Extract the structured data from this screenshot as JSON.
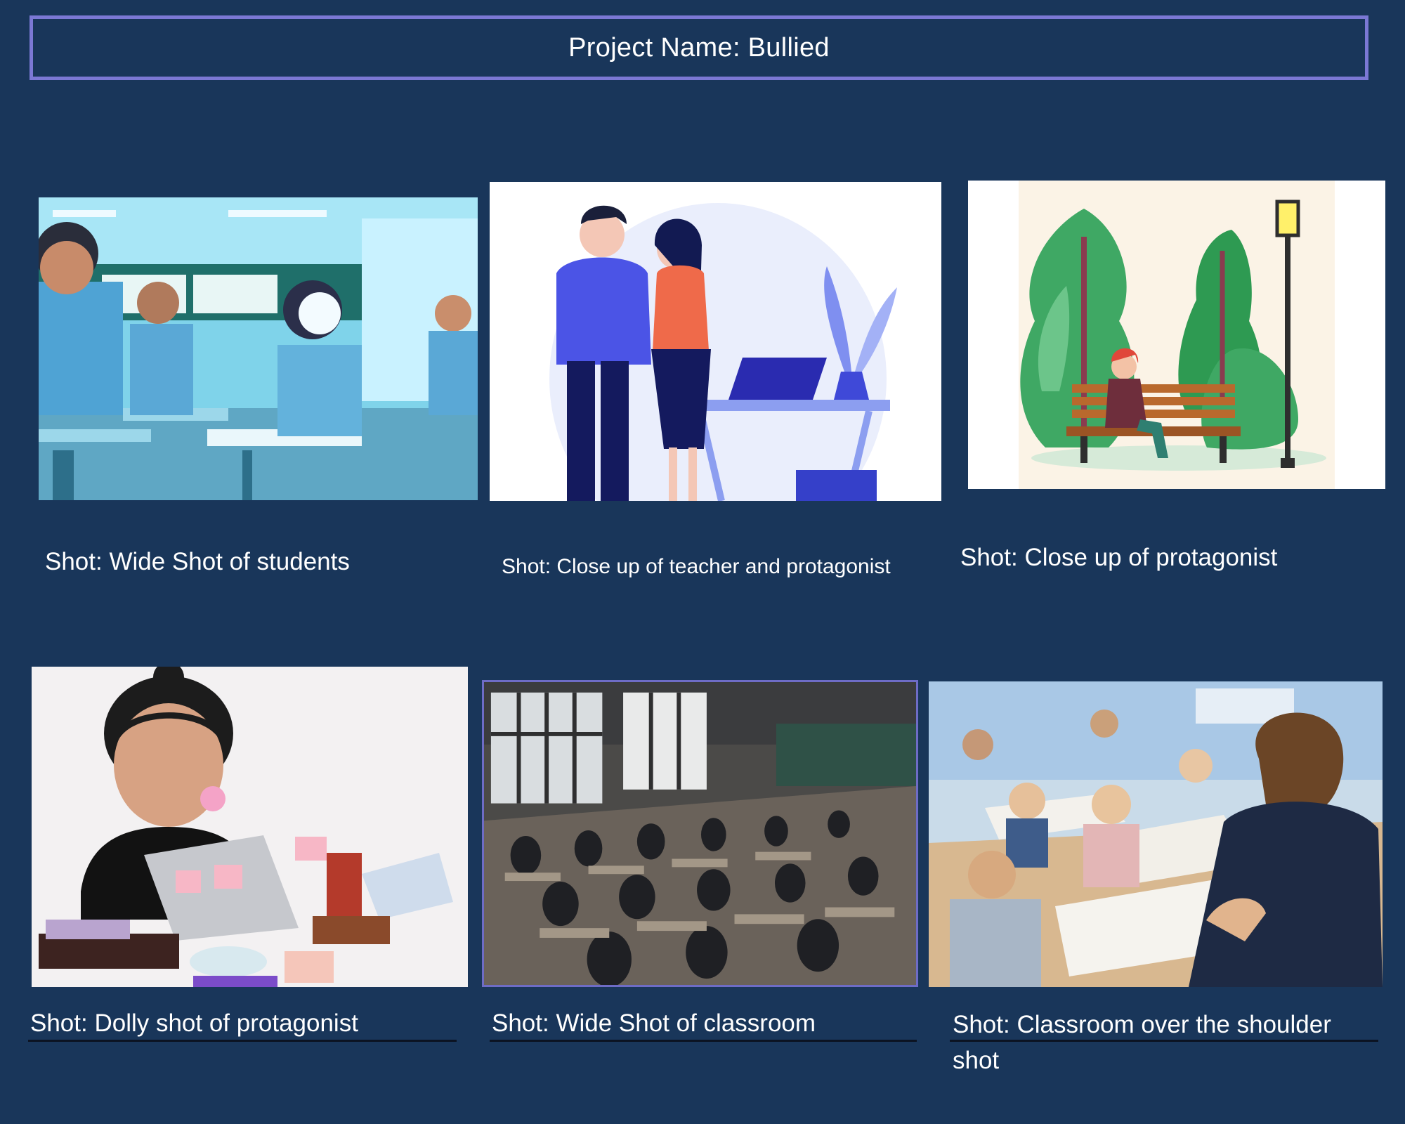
{
  "project": {
    "title": "Project Name: Bullied"
  },
  "shots": [
    {
      "caption": "Shot: Wide Shot of students"
    },
    {
      "caption": "Shot: Close up of teacher and protagonist"
    },
    {
      "caption": "Shot: Close up of protagonist"
    },
    {
      "caption": "Shot: Dolly shot of protagonist"
    },
    {
      "caption": "Shot: Wide Shot of classroom"
    },
    {
      "caption": "Shot: Classroom over the shoulder",
      "caption_cont": "shot"
    }
  ],
  "colors": {
    "background": "#19365a",
    "title_border": "#7b78d4",
    "caption_text": "#ffffff"
  }
}
